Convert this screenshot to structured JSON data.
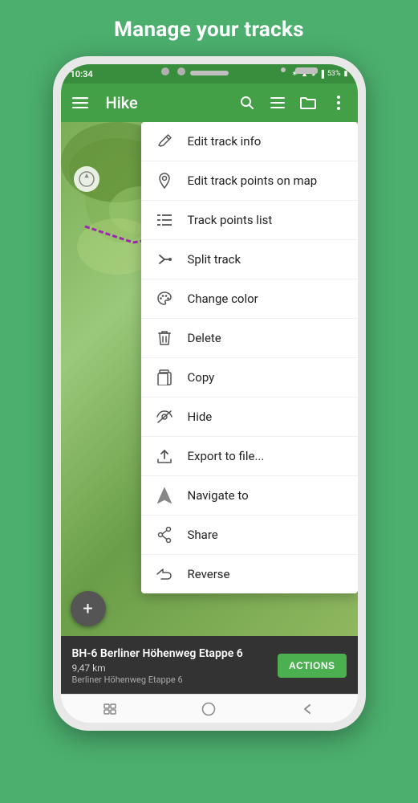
{
  "page": {
    "title": "Manage your tracks"
  },
  "status_bar": {
    "time": "10:34",
    "battery": "53%"
  },
  "app_bar": {
    "title": "Hike"
  },
  "context_menu": {
    "items": [
      {
        "id": "edit-track-info",
        "label": "Edit track info",
        "label_bold": "Edit track ",
        "label_rest": "info",
        "icon": "pencil"
      },
      {
        "id": "edit-track-points",
        "label": "Edit track points on map",
        "label_bold": "Edit track points on ",
        "label_rest": "map",
        "icon": "location-pin"
      },
      {
        "id": "track-points-list",
        "label": "Track points list",
        "icon": "list"
      },
      {
        "id": "split-track",
        "label": "Split track",
        "icon": "split"
      },
      {
        "id": "change-color",
        "label": "Change color",
        "icon": "palette"
      },
      {
        "id": "delete",
        "label": "Delete",
        "icon": "trash"
      },
      {
        "id": "copy",
        "label": "Copy",
        "icon": "copy"
      },
      {
        "id": "hide",
        "label": "Hide",
        "icon": "hide"
      },
      {
        "id": "export-to-file",
        "label": "Export to file...",
        "icon": "export"
      },
      {
        "id": "navigate-to",
        "label": "Navigate to",
        "icon": "navigate"
      },
      {
        "id": "share",
        "label": "Share",
        "icon": "share"
      },
      {
        "id": "reverse",
        "label": "Reverse",
        "icon": "reverse"
      }
    ]
  },
  "bottom_panel": {
    "track_name": "BH-6 Berliner Höhenweg Etappe 6",
    "distance": "9,47 km",
    "subtitle": "Berliner Höhenweg Etappe 6",
    "actions_label": "ACTIONS"
  },
  "fab": {
    "label": "+"
  }
}
